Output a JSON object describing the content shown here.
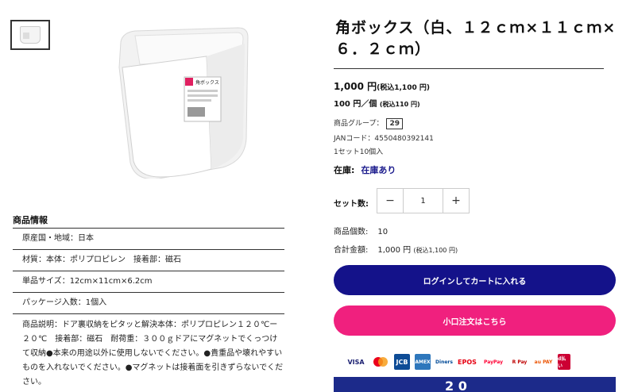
{
  "product": {
    "title": "角ボックス（白、１２ｃｍ×１１ｃｍ×６．２ｃｍ）",
    "price": "1,000 円",
    "price_tax": "(税込1,100 円)",
    "unit_price": "100 円／個",
    "unit_price_tax": "(税込110 円)",
    "group_label": "商品グループ：",
    "group_value": "29",
    "jan": "JANコード：4550480392141",
    "set_info": "1セット10個入",
    "stock_label": "在庫:",
    "stock_value": "在庫あり",
    "qty_label": "セット数:",
    "qty_minus": "−",
    "qty_value": "1",
    "qty_plus": "+",
    "count_label": "商品個数:",
    "count_value": "10",
    "total_label": "合計金額:",
    "total_value": "1,000 円",
    "total_tax": "(税込1,100 円)",
    "login_button": "ログインしてカートに入れる",
    "small_order_button": "小口注文はこちら"
  },
  "image_label": "角ボックス",
  "info": {
    "title": "商品情報",
    "rows": [
      "原産国・地域：日本",
      "材質：本体：ポリプロピレン　接着部：磁石",
      "単品サイズ：12cm×11cm×6.2cm",
      "パッケージ入数：1個入",
      "商品説明：ドア裏収納をピタッと解決本体：ポリプロピレン１２０℃ー２０℃　接着部：磁石　耐荷重：３００ｇドアにマグネットでくっつけて収納●本来の用途以外に使用しないでください。●貴重品や壊れやすいものを入れないでください。●マグネットは接着面を引きずらないでください。"
    ]
  },
  "payments": [
    "VISA",
    "MC",
    "JCB",
    "AMEX",
    "Diners",
    "EPOS",
    "PayPay",
    "R Pay",
    "au PAY",
    "d払い"
  ],
  "banner_text": "2 0",
  "colors": {
    "login": "#14128a",
    "small_order": "#f0207e",
    "stock_ok": "#1a1a8c"
  }
}
